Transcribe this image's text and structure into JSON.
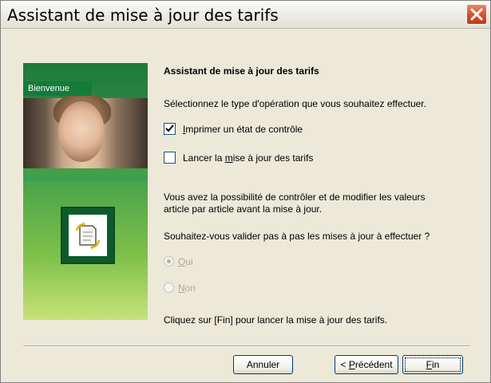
{
  "window": {
    "title": "Assistant de mise à jour des tarifs"
  },
  "sidebar": {
    "tag": "Bienvenue"
  },
  "content": {
    "heading": "Assistant de mise à jour des tarifs",
    "intro": "Sélectionnez le type d'opération que vous souhaitez effectuer.",
    "options": [
      {
        "pre": "",
        "key": "I",
        "post": "mprimer un état de contrôle",
        "checked": true
      },
      {
        "pre": "Lancer la ",
        "key": "m",
        "post": "ise à jour des tarifs",
        "checked": false
      }
    ],
    "info_line1": "Vous avez la possibilité de contrôler et de modifier les valeurs",
    "info_line2": "article par article avant la mise à jour.",
    "question": "Souhaitez-vous valider pas à pas les mises à jour à effectuer ?",
    "radios": [
      {
        "key": "O",
        "post": "ui",
        "selected": true,
        "disabled": true
      },
      {
        "key": "N",
        "post": "on",
        "selected": false,
        "disabled": true
      }
    ],
    "footer_text": "Cliquez sur [Fin] pour lancer la mise à jour des tarifs."
  },
  "buttons": {
    "cancel": "Annuler",
    "prev_pre": "< ",
    "prev_key": "P",
    "prev_post": "récédent",
    "finish_key": "F",
    "finish_post": "in"
  },
  "colors": {
    "dialog_bg": "#ece9d8",
    "close_button": "#d54d2a",
    "sidebar_green": "#1f7a3a",
    "disabled_text": "#aca899"
  }
}
